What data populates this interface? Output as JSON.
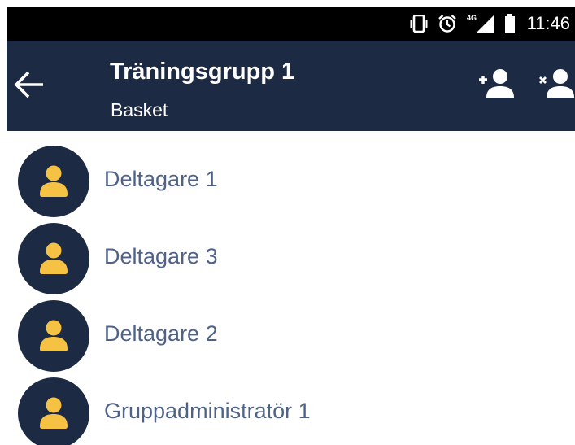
{
  "status_bar": {
    "time": "11:46",
    "network_label": "4G",
    "icons": [
      "vibrate-icon",
      "alarm-icon",
      "signal-icon",
      "battery-icon"
    ]
  },
  "app_bar": {
    "title": "Träningsgrupp 1",
    "subtitle": "Basket",
    "icons": [
      "back-arrow-icon",
      "add-person-icon",
      "remove-person-icon"
    ]
  },
  "members": [
    {
      "name": "Deltagare 1",
      "icon": "person-icon"
    },
    {
      "name": "Deltagare 3",
      "icon": "person-icon"
    },
    {
      "name": "Deltagare 2",
      "icon": "person-icon"
    },
    {
      "name": "Gruppadministratör 1",
      "icon": "person-icon"
    }
  ],
  "colors": {
    "status_bar_bg": "#000000",
    "app_bar_bg": "#1d2a44",
    "avatar_bg": "#1d2a44",
    "avatar_person": "#f6c243",
    "member_name_text": "#4f6288",
    "app_bar_text": "#ffffff"
  }
}
